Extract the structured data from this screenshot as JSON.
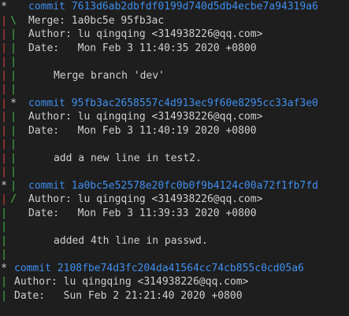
{
  "window": {
    "background": "#1e1e1e",
    "text_color": "#cfcfcf",
    "commit_color": "#3f8fef",
    "graph_colors": {
      "left_lane": "#d6423f",
      "right_lane": "#46b64a"
    }
  },
  "log": {
    "commits": [
      {
        "commit_label": "commit 7613d6ab2dbfdf0199d740d5db4ecbe7a94319a6",
        "merge": "Merge: 1a0bc5e 95fb3ac",
        "author": "Author: lu qingqing <314938226@qq.com>",
        "date": "Date:   Mon Feb 3 11:40:35 2020 +0800",
        "message": "Merge branch 'dev'"
      },
      {
        "commit_label": "commit 95fb3ac2658557c4d913ec9f60e8295cc33af3e0",
        "author": "Author: lu qingqing <314938226@qq.com>",
        "date": "Date:   Mon Feb 3 11:40:19 2020 +0800",
        "message": "add a new line in test2."
      },
      {
        "commit_label": "commit 1a0bc5e52578e20fc0b0f9b4124c00a72f1fb7fd",
        "author": "Author: lu qingqing <314938226@qq.com>",
        "date": "Date:   Mon Feb 3 11:39:33 2020 +0800",
        "message": "added 4th line in passwd."
      },
      {
        "commit_label": "commit 2108fbe74d3fc204da41564cc74cb855c0cd05a6",
        "author": "Author: lu qingqing <314938226@qq.com>",
        "date": "Date:   Sun Feb 2 21:21:40 2020 +0800"
      }
    ],
    "graph_glyphs": {
      "star": "*",
      "pipe": "|",
      "back": "\\",
      "fwd": "/"
    }
  }
}
